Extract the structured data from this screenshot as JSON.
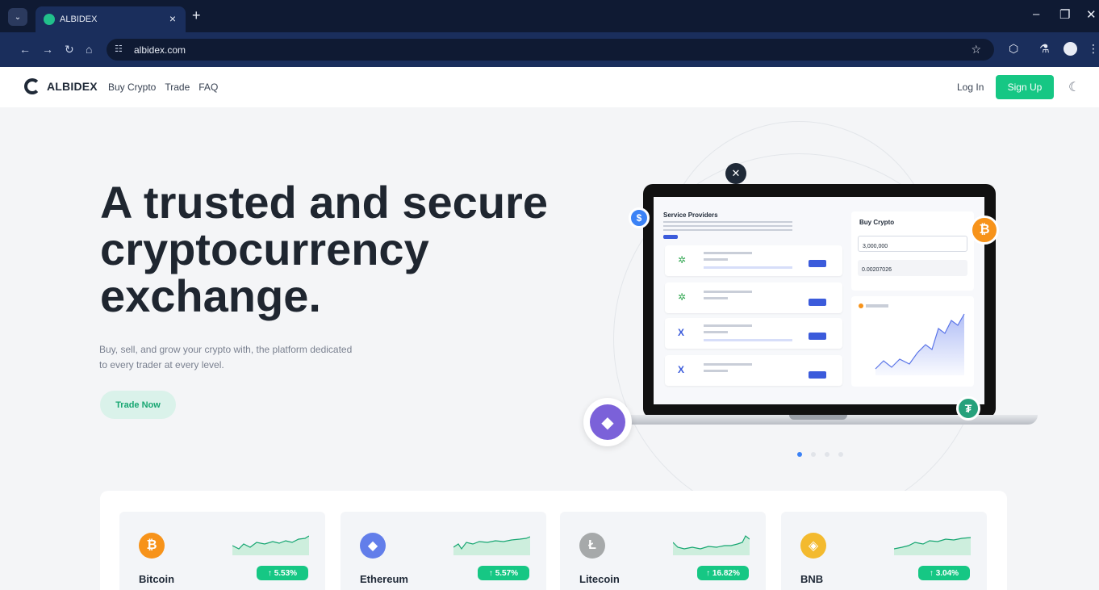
{
  "browser": {
    "tab_title": "ALBIDEX",
    "tab_close": "×",
    "new_tab": "+",
    "url": "albidex.com",
    "min": "–",
    "max": "❐",
    "close": "✕"
  },
  "nav": {
    "brand": "ALBIDEX",
    "links": [
      "Buy Crypto",
      "Trade",
      "FAQ"
    ],
    "login": "Log In",
    "signup": "Sign Up"
  },
  "hero": {
    "title_line1": "A trusted and secure",
    "title_line2": "cryptocurrency",
    "title_line3": "exchange.",
    "subtitle_line1": "Buy, sell, and grow your crypto with, the platform dedicated",
    "subtitle_line2": "to every trader at every level.",
    "cta": "Trade Now"
  },
  "illustration": {
    "service_title": "Service Providers",
    "buy_title": "Buy Crypto",
    "amount": "3,000,000",
    "crypto_amount": "0.00207026"
  },
  "markets": [
    {
      "name": "Bitcoin",
      "change": "↑ 5.53%",
      "icon": "bitcoin-icon",
      "symbol": "₿",
      "color": "#f7931a"
    },
    {
      "name": "Ethereum",
      "change": "↑ 5.57%",
      "icon": "ethereum-icon",
      "symbol": "◆",
      "color": "#627eea"
    },
    {
      "name": "Litecoin",
      "change": "↑ 16.82%",
      "icon": "litecoin-icon",
      "symbol": "Ł",
      "color": "#a6a9aa"
    },
    {
      "name": "BNB",
      "change": "↑ 3.04%",
      "icon": "bnb-icon",
      "symbol": "◈",
      "color": "#f3ba2f"
    }
  ],
  "colors": {
    "accent": "#16c784",
    "dark": "#0f1a33"
  }
}
